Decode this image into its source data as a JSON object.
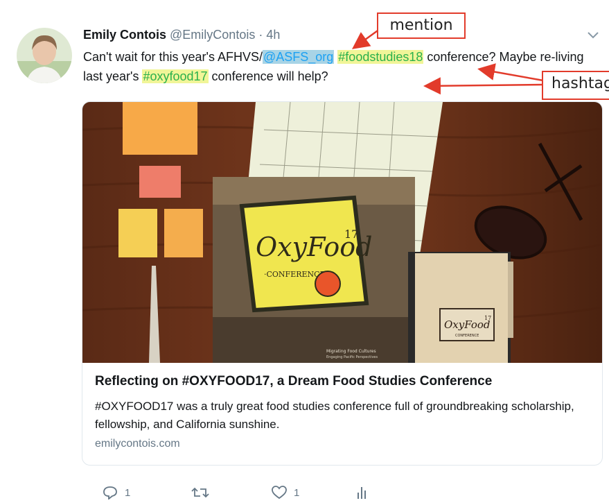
{
  "tweet": {
    "author_name": "Emily Contois",
    "handle": "@EmilyContois",
    "separator": " · ",
    "time": "4h",
    "text_part1": "Can't wait for this year's AFHVS/",
    "mention": "@ASFS_org",
    "text_space": " ",
    "hashtag1": "#foodstudies18",
    "text_part2": " conference? Maybe re-living last year's ",
    "hashtag2": "#oxyfood17",
    "text_part3": " conference will help?"
  },
  "annotations": {
    "mention_label": "mention",
    "hashtag_label": "hashtag",
    "color": "#e23b2b"
  },
  "card": {
    "title": "Reflecting on #OXYFOOD17, a Dream Food Studies Conference",
    "description": "#OXYFOOD17 was a truly great food studies conference full of groundbreaking scholarship, fellowship, and California sunshine.",
    "domain": "emilycontois.com",
    "image": {
      "sign_text": "OxyFood",
      "sign_superscript": "17",
      "sign_subtitle": "·CONFERENCE·",
      "book_text": "Migrating Food Cultures",
      "book_subtitle": "Engaging Pacific Perspectives",
      "notebook_text": "OxyFood",
      "notebook_superscript": "17",
      "notebook_subtitle": "CONFERENCE"
    }
  },
  "actions": {
    "reply_count": "1",
    "like_count": "1"
  },
  "colors": {
    "mention_highlight": "#a8d4e6",
    "hashtag_highlight": "#f1f598",
    "link_blue": "#1da1f2",
    "hashtag_green": "#2bb14c",
    "meta_gray": "#657786"
  },
  "icons": [
    "reply-icon",
    "retweet-icon",
    "like-icon",
    "analytics-icon",
    "chevron-down-icon"
  ]
}
